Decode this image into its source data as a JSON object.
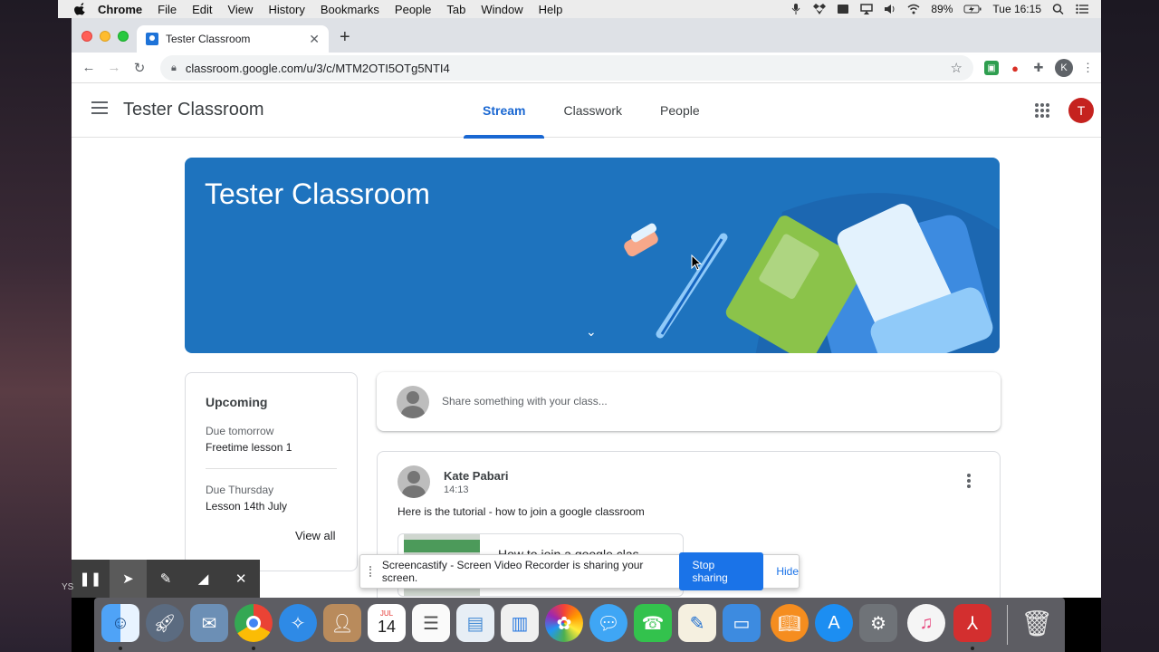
{
  "menubar": {
    "app": "Chrome",
    "items": [
      "File",
      "Edit",
      "View",
      "History",
      "Bookmarks",
      "People",
      "Tab",
      "Window",
      "Help"
    ],
    "battery": "89%",
    "clock": "Tue 16:15"
  },
  "browser": {
    "tab_title": "Tester Classroom",
    "url": "classroom.google.com/u/3/c/MTM2OTI5OTg5NTI4",
    "profile_initial": "K"
  },
  "classroom": {
    "class_name": "Tester Classroom",
    "tabs": [
      "Stream",
      "Classwork",
      "People"
    ],
    "active_tab": "Stream",
    "user_initial": "T",
    "banner_title": "Tester Classroom",
    "upcoming": {
      "title": "Upcoming",
      "items": [
        {
          "due": "Due tomorrow",
          "name": "Freetime lesson 1"
        },
        {
          "due": "Due Thursday",
          "name": "Lesson 14th July"
        }
      ],
      "view_all": "View all"
    },
    "share_placeholder": "Share something with your class...",
    "post": {
      "author": "Kate Pabari",
      "time": "14:13",
      "body": "Here is the tutorial - how to join a google classroom",
      "attachment_title": "How to join a google clas"
    }
  },
  "screencastify": {
    "notice": "Screencastify - Screen Video Recorder is sharing your screen.",
    "stop_label": "Stop sharing",
    "hide_label": "Hide"
  },
  "desktop_label": "YS",
  "dock": {
    "calendar_month": "JUL",
    "calendar_day": "14"
  },
  "colors": {
    "classroom_blue": "#1967d2",
    "banner_blue": "#1e73be",
    "avatar_red": "#c5221f",
    "stop_button": "#1a73e8"
  }
}
